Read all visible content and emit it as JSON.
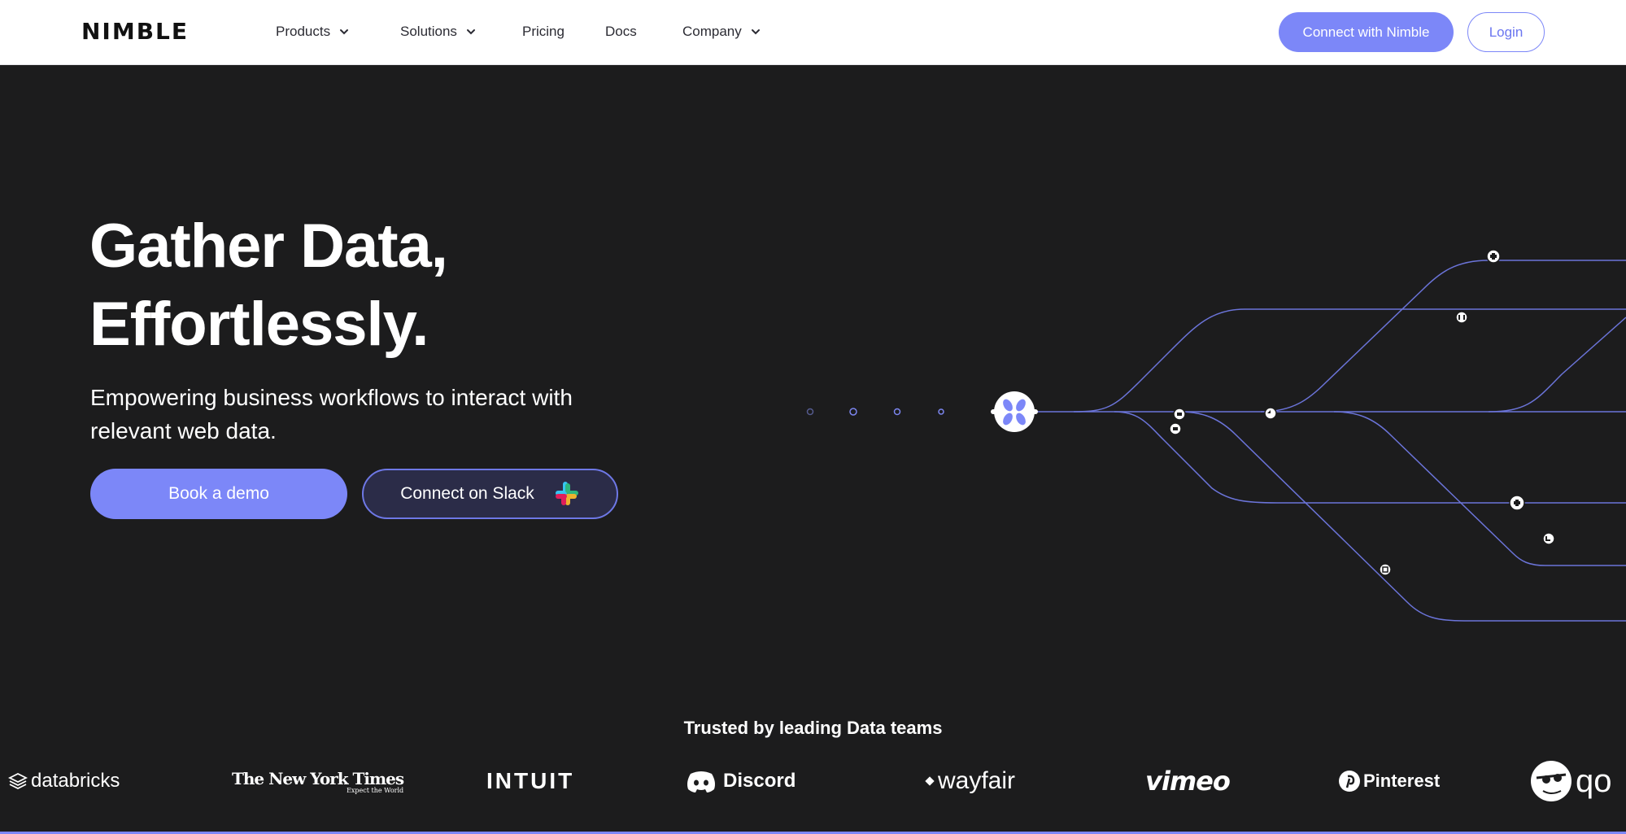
{
  "nav": {
    "logo_text": "NIMBLE",
    "items": [
      {
        "label": "Products",
        "has_dropdown": true
      },
      {
        "label": "Solutions",
        "has_dropdown": true
      },
      {
        "label": "Pricing",
        "has_dropdown": false
      },
      {
        "label": "Docs",
        "has_dropdown": false
      },
      {
        "label": "Company",
        "has_dropdown": true
      }
    ],
    "connect_label": "Connect with Nimble",
    "login_label": "Login"
  },
  "hero": {
    "headline_line1": "Gather Data,",
    "headline_line2": "Effortlessly.",
    "subtitle": "Empowering business workflows to interact with relevant web data.",
    "demo_label": "Book a demo",
    "slack_label": "Connect on Slack"
  },
  "trusted": {
    "heading": "Trusted by leading Data teams",
    "brands": [
      "databricks",
      "The New York Times",
      "INTUIT",
      "Discord",
      "wayfair",
      "vimeo",
      "Pinterest",
      "qo"
    ],
    "nyt_tagline": "Expect the World"
  },
  "colors": {
    "accent": "#7c87f8",
    "background": "#1c1c1d",
    "navbar": "#ffffff",
    "slack_button": "#2b2c48"
  }
}
